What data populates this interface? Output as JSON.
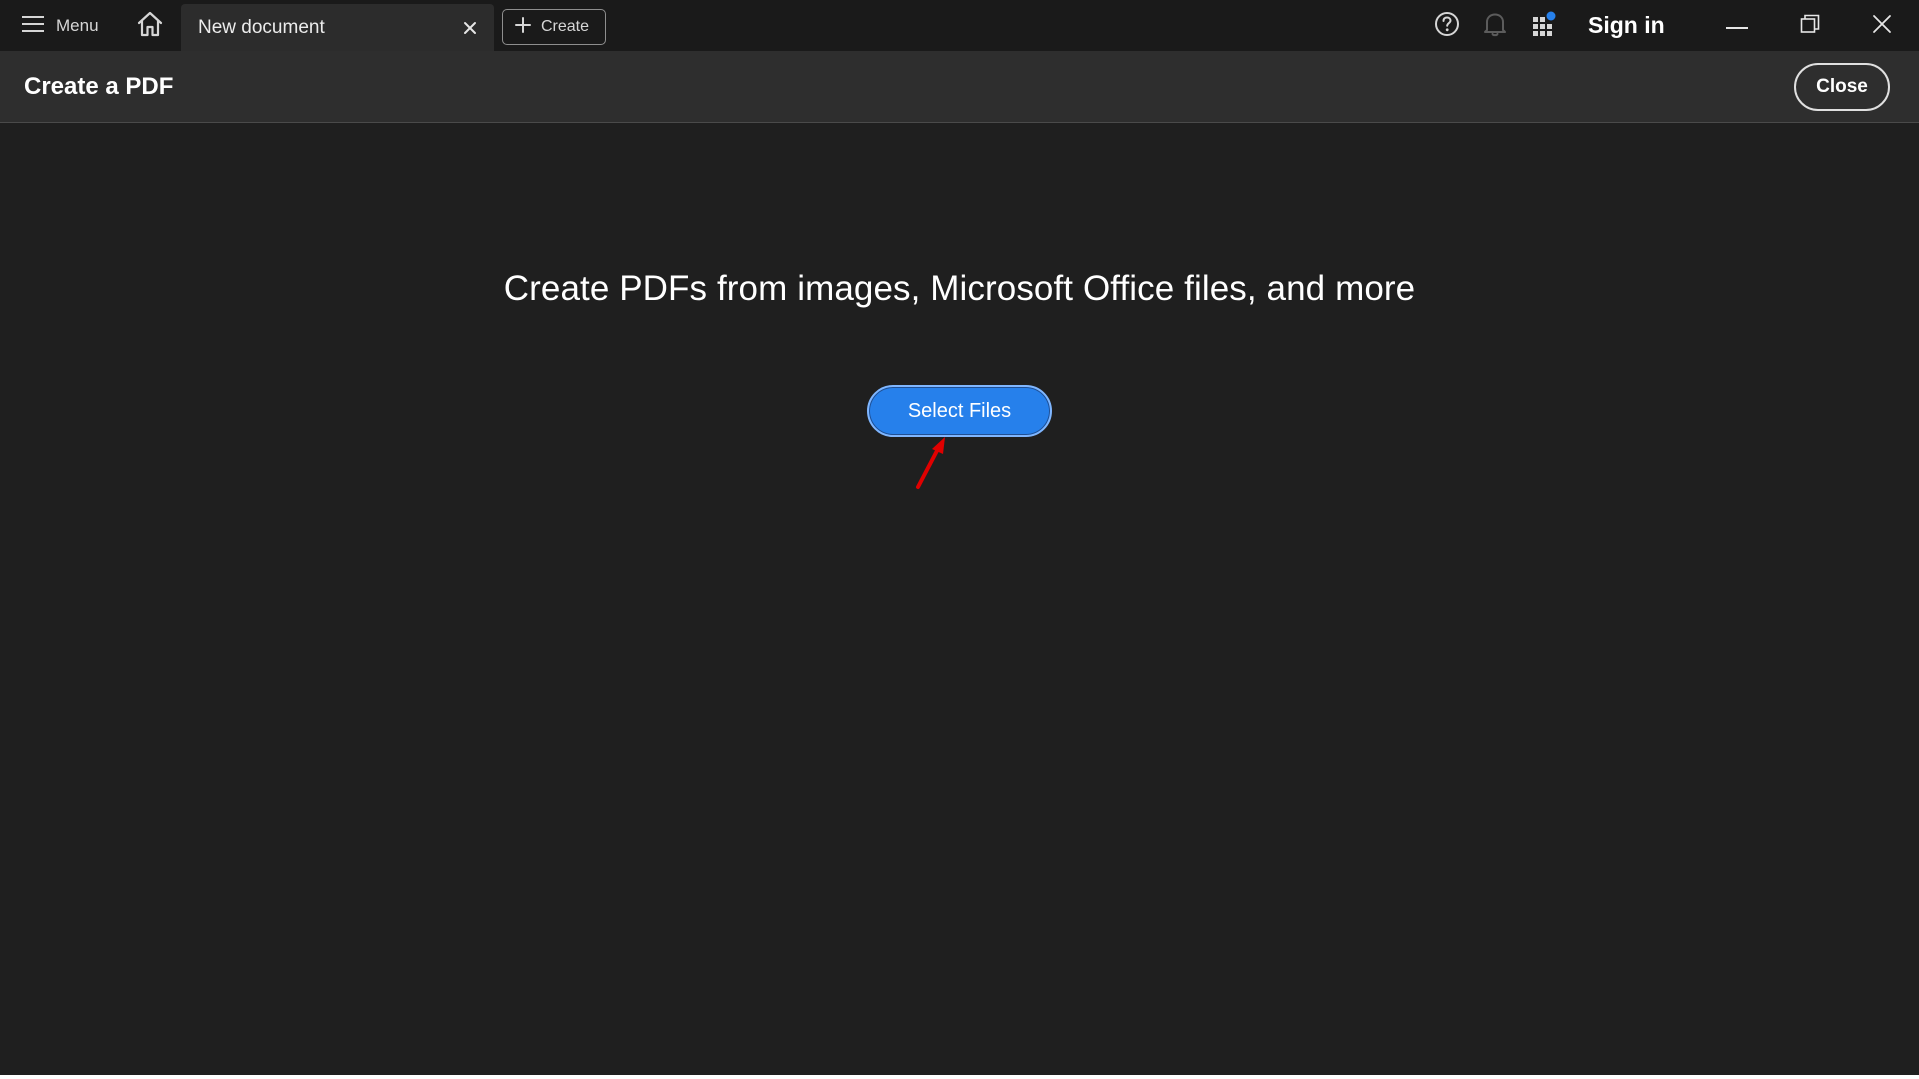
{
  "titlebar": {
    "menu_label": "Menu",
    "tab_label": "New document",
    "create_label": "Create",
    "signin_label": "Sign in"
  },
  "header": {
    "title": "Create a PDF",
    "close_label": "Close"
  },
  "main": {
    "headline": "Create PDFs from images, Microsoft Office files, and more",
    "select_files_label": "Select Files"
  },
  "icons": [
    "hamburger-icon",
    "home-icon",
    "close-icon",
    "plus-icon",
    "help-icon",
    "bell-icon",
    "apps-grid-icon",
    "minimize-icon",
    "restore-icon",
    "window-close-icon",
    "annotation-arrow"
  ],
  "colors": {
    "accent": "#2680eb",
    "notification_dot": "#2680eb",
    "annotation": "#e00000"
  }
}
